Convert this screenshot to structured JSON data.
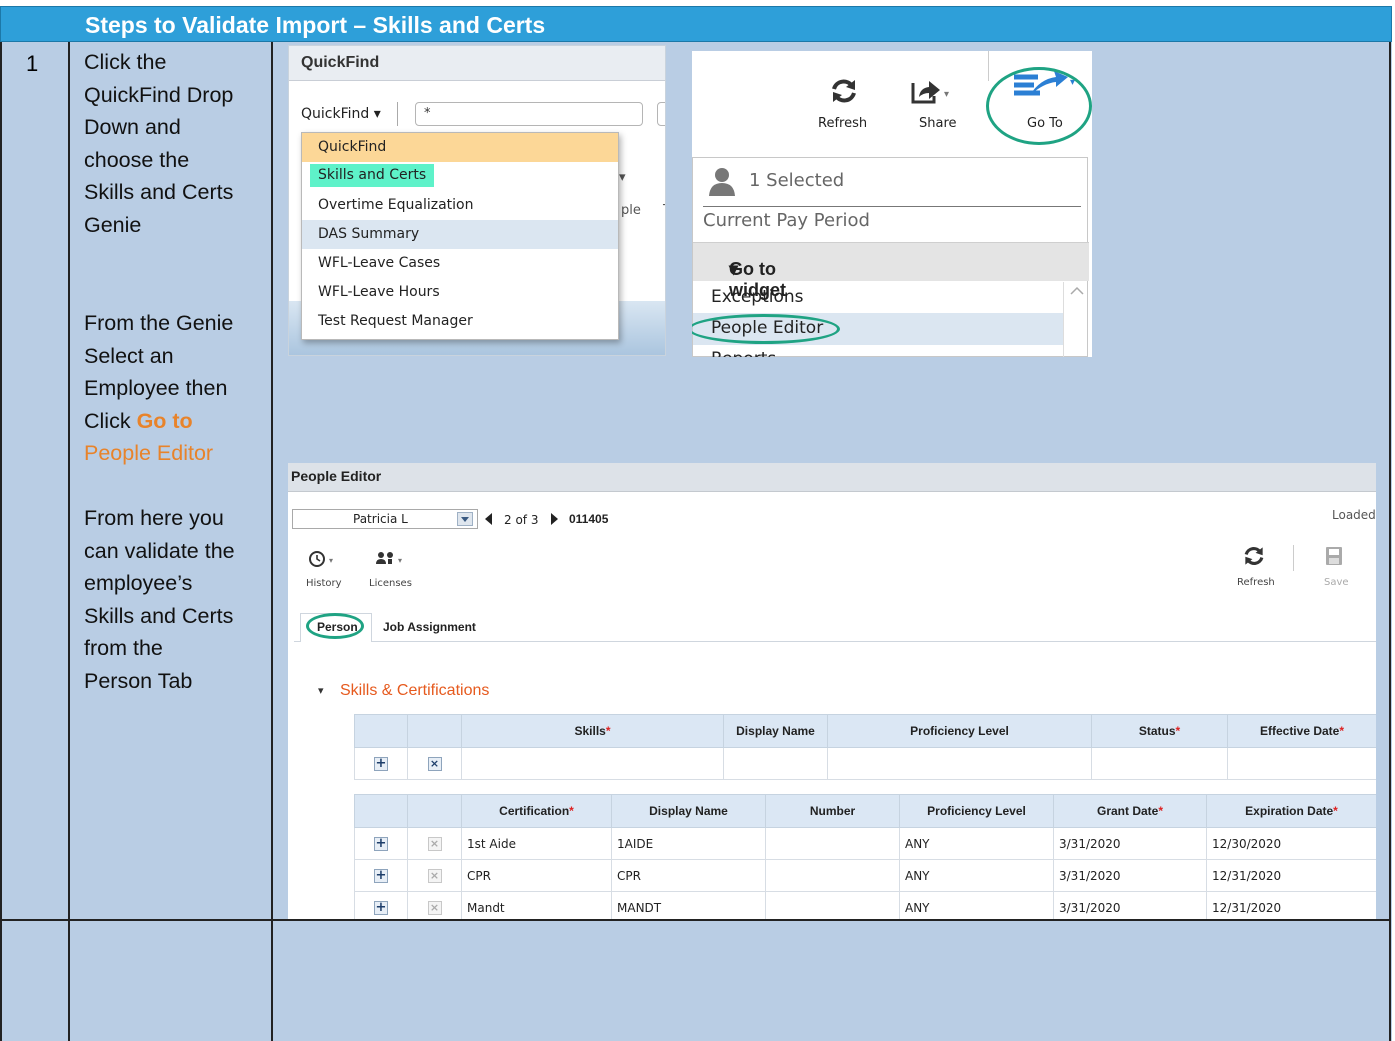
{
  "header": {
    "title": "Steps to Validate Import – Skills and Certs"
  },
  "step": {
    "number": "1",
    "para1": [
      "Click the",
      "QuickFind Drop",
      "Down and",
      "choose the",
      "Skills and Certs",
      "Genie"
    ],
    "para2": {
      "l1": "From the Genie",
      "l2": "Select an",
      "l3": "Employee then",
      "l4_plain": "Click ",
      "l4_bold": "Go to",
      "l5": "People Editor"
    },
    "para3": [
      "From here you",
      "can validate the",
      "employee’s",
      "Skills and Certs",
      "from the",
      "Person Tab"
    ]
  },
  "quickfind": {
    "panel_title": "QuickFind",
    "dropdown_label": "QuickFind",
    "search_value": "*",
    "menu": [
      "QuickFind",
      "Skills and Certs",
      "Overtime Equalization",
      "DAS Summary",
      "WFL-Leave Cases",
      "WFL-Leave Hours",
      "Test Request Manager"
    ],
    "bg_fragments": [
      "ple",
      "T"
    ]
  },
  "goto_panel": {
    "toolbar": {
      "refresh": "Refresh",
      "share": "Share",
      "goto": "Go To"
    },
    "selected": "1 Selected",
    "pay_period": "Current Pay Period",
    "widget_header": "Go to widget",
    "items": [
      "Exceptions",
      "People Editor",
      "Reports"
    ]
  },
  "people_editor": {
    "title": "People Editor",
    "employee_name": "Patricia L",
    "pager": "2 of 3",
    "employee_id": "011405",
    "status": "Loaded",
    "tools": {
      "history": "History",
      "licenses": "Licenses",
      "refresh": "Refresh",
      "save": "Save"
    },
    "tabs": [
      "Person",
      "Job Assignment"
    ],
    "section": "Skills & Certifications",
    "skills_headers": [
      "Skills",
      "Display Name",
      "Proficiency Level",
      "Status",
      "Effective Date"
    ],
    "cert_headers": [
      "Certification",
      "Display Name",
      "Number",
      "Proficiency Level",
      "Grant Date",
      "Expiration Date"
    ],
    "certs": [
      {
        "certification": "1st Aide",
        "display_name": "1AIDE",
        "number": "",
        "proficiency": "ANY",
        "grant_date": "3/31/2020",
        "expiration_date": "12/30/2020"
      },
      {
        "certification": "CPR",
        "display_name": "CPR",
        "number": "",
        "proficiency": "ANY",
        "grant_date": "3/31/2020",
        "expiration_date": "12/31/2020"
      },
      {
        "certification": "Mandt",
        "display_name": "MANDT",
        "number": "",
        "proficiency": "ANY",
        "grant_date": "3/31/2020",
        "expiration_date": "12/31/2020"
      }
    ]
  },
  "colors": {
    "header_blue": "#2e9fd9",
    "cell_blue": "#b9cde4",
    "highlight_teal": "#1fa383",
    "accent_orange": "#e8832a"
  }
}
